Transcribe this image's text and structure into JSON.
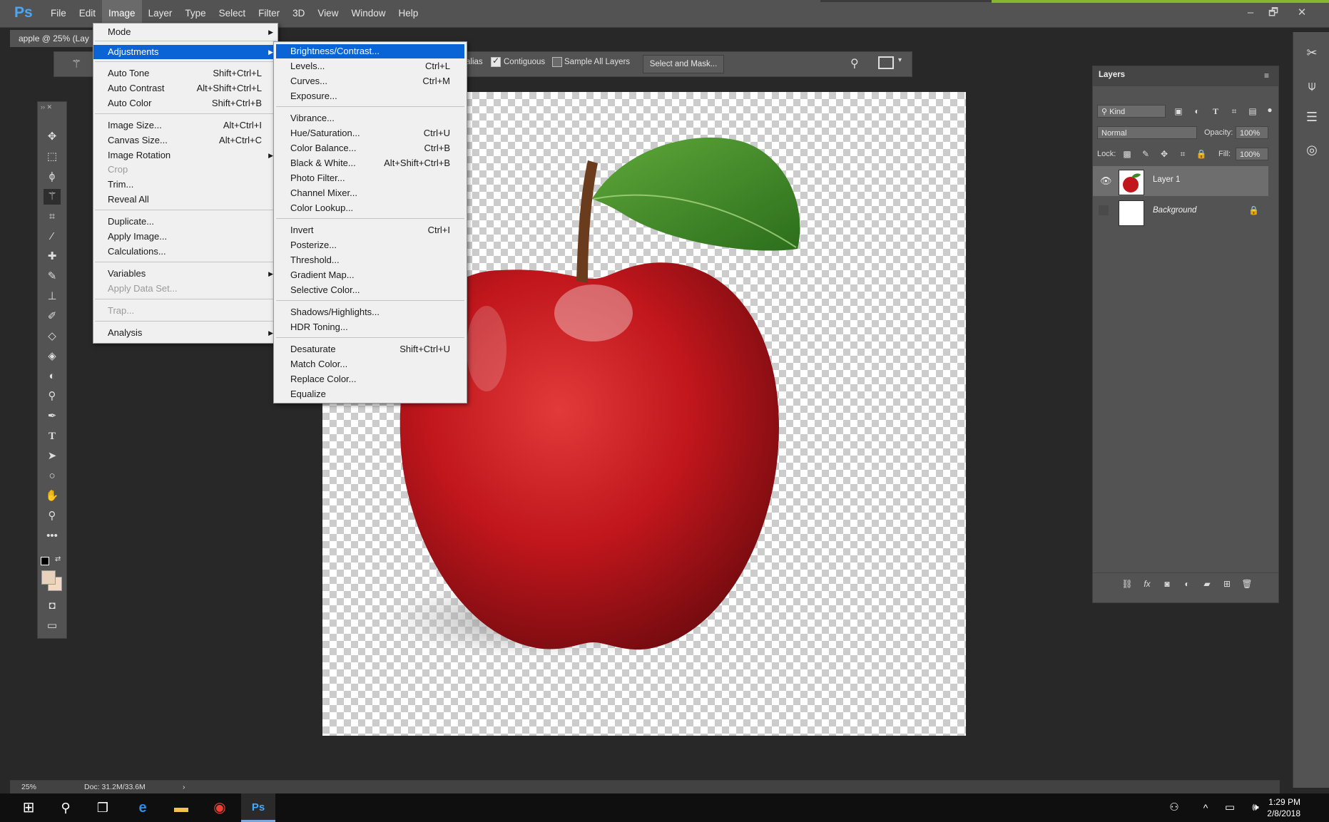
{
  "app": {
    "logo": "Ps",
    "menus": [
      "File",
      "Edit",
      "Image",
      "Layer",
      "Type",
      "Select",
      "Filter",
      "3D",
      "View",
      "Window",
      "Help"
    ],
    "active_menu": "Image",
    "window_controls": {
      "minimize": "–",
      "restore": "🗗",
      "close": "✕"
    }
  },
  "document_tab": {
    "title": "apple @ 25% (Lay"
  },
  "options_bar": {
    "antialias_partial": "alias",
    "contiguous_label": "Contiguous",
    "contiguous_checked": true,
    "sample_all_label": "Sample All Layers",
    "sample_all_checked": false,
    "select_mask_label": "Select and Mask..."
  },
  "image_menu": {
    "items": [
      {
        "label": "Mode",
        "submenu": true
      },
      {
        "label": "Adjustments",
        "submenu": true,
        "highlighted": true
      },
      {
        "label": "Auto Tone",
        "shortcut": "Shift+Ctrl+L"
      },
      {
        "label": "Auto Contrast",
        "shortcut": "Alt+Shift+Ctrl+L"
      },
      {
        "label": "Auto Color",
        "shortcut": "Shift+Ctrl+B"
      },
      {
        "label": "Image Size...",
        "shortcut": "Alt+Ctrl+I"
      },
      {
        "label": "Canvas Size...",
        "shortcut": "Alt+Ctrl+C"
      },
      {
        "label": "Image Rotation",
        "submenu": true
      },
      {
        "label": "Crop",
        "disabled": true
      },
      {
        "label": "Trim..."
      },
      {
        "label": "Reveal All"
      },
      {
        "label": "Duplicate..."
      },
      {
        "label": "Apply Image..."
      },
      {
        "label": "Calculations..."
      },
      {
        "label": "Variables",
        "submenu": true
      },
      {
        "label": "Apply Data Set...",
        "disabled": true
      },
      {
        "label": "Trap...",
        "disabled": true
      },
      {
        "label": "Analysis",
        "submenu": true
      }
    ]
  },
  "adjustments_menu": {
    "items": [
      {
        "label": "Brightness/Contrast...",
        "highlighted": true
      },
      {
        "label": "Levels...",
        "shortcut": "Ctrl+L"
      },
      {
        "label": "Curves...",
        "shortcut": "Ctrl+M"
      },
      {
        "label": "Exposure..."
      },
      {
        "label": "Vibrance..."
      },
      {
        "label": "Hue/Saturation...",
        "shortcut": "Ctrl+U"
      },
      {
        "label": "Color Balance...",
        "shortcut": "Ctrl+B"
      },
      {
        "label": "Black & White...",
        "shortcut": "Alt+Shift+Ctrl+B"
      },
      {
        "label": "Photo Filter..."
      },
      {
        "label": "Channel Mixer..."
      },
      {
        "label": "Color Lookup..."
      },
      {
        "label": "Invert",
        "shortcut": "Ctrl+I"
      },
      {
        "label": "Posterize..."
      },
      {
        "label": "Threshold..."
      },
      {
        "label": "Gradient Map..."
      },
      {
        "label": "Selective Color..."
      },
      {
        "label": "Shadows/Highlights..."
      },
      {
        "label": "HDR Toning..."
      },
      {
        "label": "Desaturate",
        "shortcut": "Shift+Ctrl+U"
      },
      {
        "label": "Match Color..."
      },
      {
        "label": "Replace Color..."
      },
      {
        "label": "Equalize"
      }
    ]
  },
  "layers_panel": {
    "tab": "Layers",
    "filter_kind": "Kind",
    "blend_mode": "Normal",
    "opacity_label": "Opacity:",
    "opacity_value": "100%",
    "lock_label": "Lock:",
    "fill_label": "Fill:",
    "fill_value": "100%",
    "layers": [
      {
        "name": "Layer 1",
        "visible": true,
        "selected": true
      },
      {
        "name": "Background",
        "visible": false,
        "locked": true,
        "italic": true
      }
    ]
  },
  "status_bar": {
    "zoom": "25%",
    "doc_info": "Doc: 31.2M/33.6M"
  },
  "taskbar": {
    "time": "1:29 PM",
    "date": "2/8/2018"
  },
  "colors": {
    "menu_highlight": "#0a64d6",
    "panel_bg": "#535353",
    "app_bg": "#282828",
    "apple_red": "#c0161c"
  }
}
